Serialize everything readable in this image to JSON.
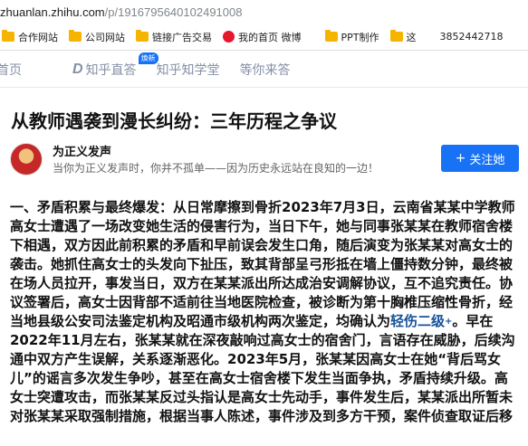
{
  "browser": {
    "url_host": "zhuanlan.zhihu.com",
    "url_path": "/p/1916795640102491008"
  },
  "bookmarks": {
    "items": [
      {
        "label": "合作网站",
        "icon": "folder-icon"
      },
      {
        "label": "公司网站",
        "icon": "folder-icon"
      },
      {
        "label": "链接广告交易",
        "icon": "folder-icon"
      },
      {
        "label": "我的首页 微博",
        "icon": "weibo-icon"
      },
      {
        "label": "PPT制作",
        "icon": "folder-icon"
      },
      {
        "label": "这",
        "icon": "folder-icon"
      }
    ],
    "extra_text": "3852442718"
  },
  "nav": {
    "home": "首页",
    "zhidao": "知乎直答",
    "zhidao_badge": "焕新",
    "xuetang": "知乎知学堂",
    "waiting": "等你来答"
  },
  "article": {
    "title": "从教师遇袭到漫长纠纷：三年历程之争议",
    "author_name": "为正义发声",
    "author_bio": "当你为正义发声时，你并不孤单——因为历史永远站在良知的一边！",
    "follow_label": "关注她",
    "lines": [
      "一、矛盾积累与最终爆发：从日常摩擦到骨折2023年7月3日，云南省某某中学教师",
      "高女士遭遇了一场改变她生活的侵害行为，当日下午，她与同事张某某在教师宿舍楼",
      "下相遇，双方因此前积累的矛盾和早前误会发生口角，随后演变为张某某对高女士的",
      "袭击。她抓住高女士的头发向下扯压，致其背部呈弓形抵在墙上僵持数分钟，最终被",
      "在场人员拉开，事发当日，双方在某某派出所达成治安调解协议，互不追究责任。协",
      "议签署后，高女士因背部不适前往当地医院检查，被诊断为第十胸椎压缩性骨折，经",
      "当地县级公安司法鉴定机构及昭通市级机构两次鉴定，均确认为",
      "2022年11月左右，张某某就在深夜敲响过高女士的宿舍门，言语存在威胁，后续沟",
      "通中双方产生误解，关系逐渐恶化。2023年5月，张某某因高女士在她“背后骂女",
      "儿”的谣言多次发生争吵，甚至在高女士宿舍楼下发生当面争执，矛盾持续升级。高",
      "女士突遭攻击，而张某某反过头指认是高女士先动手，事件发生后，某某派出所暂未",
      "对张某某采取强制措施，根据当事人陈述，事件涉及到多方干预，案件侦查取证后移"
    ],
    "injury_link": "轻伤二级",
    "injury_sup": "+",
    "line7_tail": "。早在"
  },
  "colors": {
    "accent": "#1772f6",
    "link": "#175199",
    "muted": "#8590a6"
  }
}
